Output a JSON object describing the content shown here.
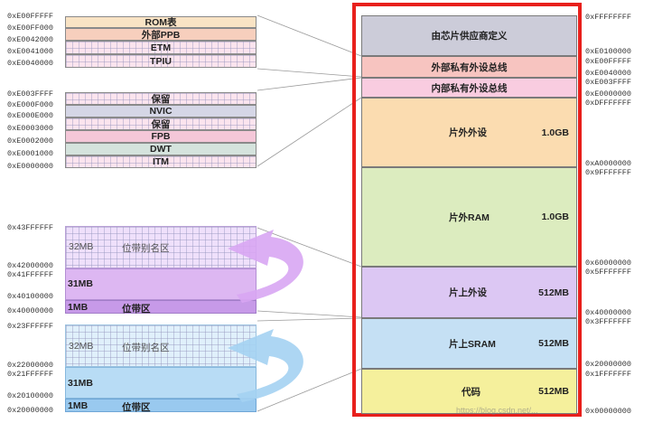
{
  "left_top": {
    "blocks": [
      {
        "label": "ROM表",
        "color": "#f9e3c4",
        "grid": false
      },
      {
        "label": "外部PPB",
        "color": "#f7cfbd",
        "grid": false
      },
      {
        "label": "ETM",
        "color": "#fbe4ee",
        "grid": true
      },
      {
        "label": "TPIU",
        "color": "#fbe4ee",
        "grid": true
      }
    ],
    "addresses": [
      "0xE00FFFFF",
      "0xE00FF000",
      "0xE0042000",
      "0xE0041000",
      "0xE0040000"
    ]
  },
  "left_mid": {
    "blocks": [
      {
        "label": "保留",
        "color": "#fbe4ee",
        "grid": true
      },
      {
        "label": "NVIC",
        "color": "#d5d6e6",
        "grid": false
      },
      {
        "label": "保留",
        "color": "#fbe4ee",
        "grid": true
      },
      {
        "label": "FPB",
        "color": "#f4c7d8",
        "grid": false
      },
      {
        "label": "DWT",
        "color": "#d5e3dd",
        "grid": false
      },
      {
        "label": "ITM",
        "color": "#fbe4ee",
        "grid": true
      }
    ],
    "addresses": [
      "0xE003FFFF",
      "0xE000F000",
      "0xE000E000",
      "0xE0003000",
      "0xE0002000",
      "0xE0001000",
      "0xE0000000"
    ]
  },
  "sram_bitband": {
    "alias_size": "32MB",
    "alias_label": "位带别名区",
    "mid_size": "31MB",
    "band_size": "1MB",
    "band_label": "位带区",
    "addresses": [
      "0x43FFFFFF",
      "0x42000000",
      "0x41FFFFFF",
      "0x40100000",
      "0x40000000"
    ]
  },
  "periph_bitband": {
    "alias_size": "32MB",
    "alias_label": "位带别名区",
    "mid_size": "31MB",
    "band_size": "1MB",
    "band_label": "位带区",
    "addresses": [
      "0x23FFFFFF",
      "0x22000000",
      "0x21FFFFFF",
      "0x20100000",
      "0x20000000"
    ]
  },
  "memory_map": {
    "regions": [
      {
        "name": "由芯片供应商定义",
        "size": "",
        "color": "#ccccd9"
      },
      {
        "name": "外部私有外设总线",
        "size": "",
        "color": "#f7c4c0"
      },
      {
        "name": "内部私有外设总线",
        "size": "",
        "color": "#f9cce0"
      },
      {
        "name": "片外外设",
        "size": "1.0GB",
        "color": "#fbdcb0"
      },
      {
        "name": "片外RAM",
        "size": "1.0GB",
        "color": "#dcecbf"
      },
      {
        "name": "片上外设",
        "size": "512MB",
        "color": "#dcc7f3"
      },
      {
        "name": "片上SRAM",
        "size": "512MB",
        "color": "#c5e0f4"
      },
      {
        "name": "代码",
        "size": "512MB",
        "color": "#f5f09c"
      }
    ],
    "addresses": [
      "0xFFFFFFFF",
      "0xE0100000",
      "0xE00FFFFF",
      "0xE0040000",
      "0xE003FFFF",
      "0xE0000000",
      "0xDFFFFFFF",
      "0xA0000000",
      "0x9FFFFFFF",
      "0x60000000",
      "0x5FFFFFFF",
      "0x40000000",
      "0x3FFFFFFF",
      "0x20000000",
      "0x1FFFFFFF",
      "0x00000000"
    ]
  },
  "colors": {
    "frame_red": "#e8201c",
    "sram_bitband": "#ddb7f2",
    "sram_bitband_dark": "#c79ae8",
    "periph_bitband": "#b8dcf5",
    "periph_bitband_dark": "#99c9ef",
    "arrow_purple": "#d8a6f3",
    "arrow_blue": "#a4d2f2"
  },
  "watermark": "https://blog.csdn.net/..."
}
